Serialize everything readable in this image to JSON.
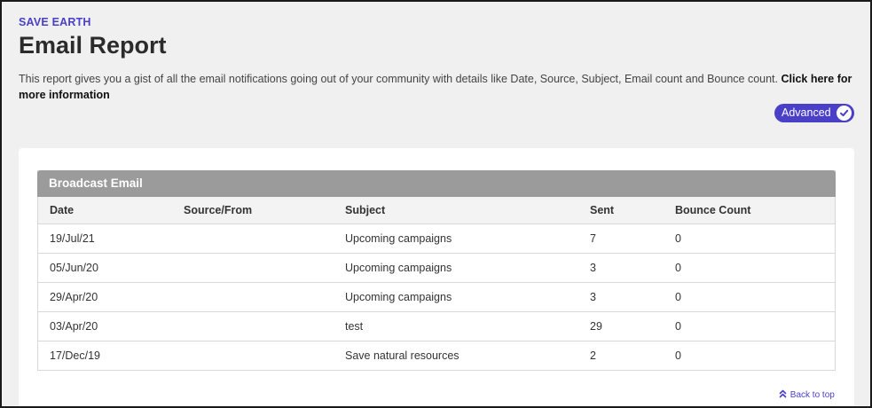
{
  "header": {
    "org_name": "SAVE EARTH",
    "title": "Email Report",
    "description": "This report gives you a gist of all the email notifications going out of your community with details like Date, Source, Subject, Email count and Bounce count.",
    "info_link": "Click here for more information"
  },
  "toggle": {
    "label": "Advanced",
    "checked": true,
    "icon": "check-icon"
  },
  "panel": {
    "title": "Broadcast Email",
    "columns": [
      "Date",
      "Source/From",
      "Subject",
      "Sent",
      "Bounce Count"
    ],
    "rows": [
      {
        "date": "19/Jul/21",
        "source": "",
        "subject": "Upcoming campaigns",
        "sent": "7",
        "bounce": "0"
      },
      {
        "date": "05/Jun/20",
        "source": "",
        "subject": "Upcoming campaigns",
        "sent": "3",
        "bounce": "0"
      },
      {
        "date": "29/Apr/20",
        "source": "",
        "subject": "Upcoming campaigns",
        "sent": "3",
        "bounce": "0"
      },
      {
        "date": "03/Apr/20",
        "source": "",
        "subject": "test",
        "sent": "29",
        "bounce": "0"
      },
      {
        "date": "17/Dec/19",
        "source": "",
        "subject": "Save natural resources",
        "sent": "2",
        "bounce": "0"
      }
    ]
  },
  "footer": {
    "back_to_top": "Back to top",
    "icon": "double-chevron-up-icon"
  },
  "colors": {
    "accent": "#4a3fc7",
    "panel_header": "#9b9b9b",
    "page_bg": "#f0f0f0"
  }
}
